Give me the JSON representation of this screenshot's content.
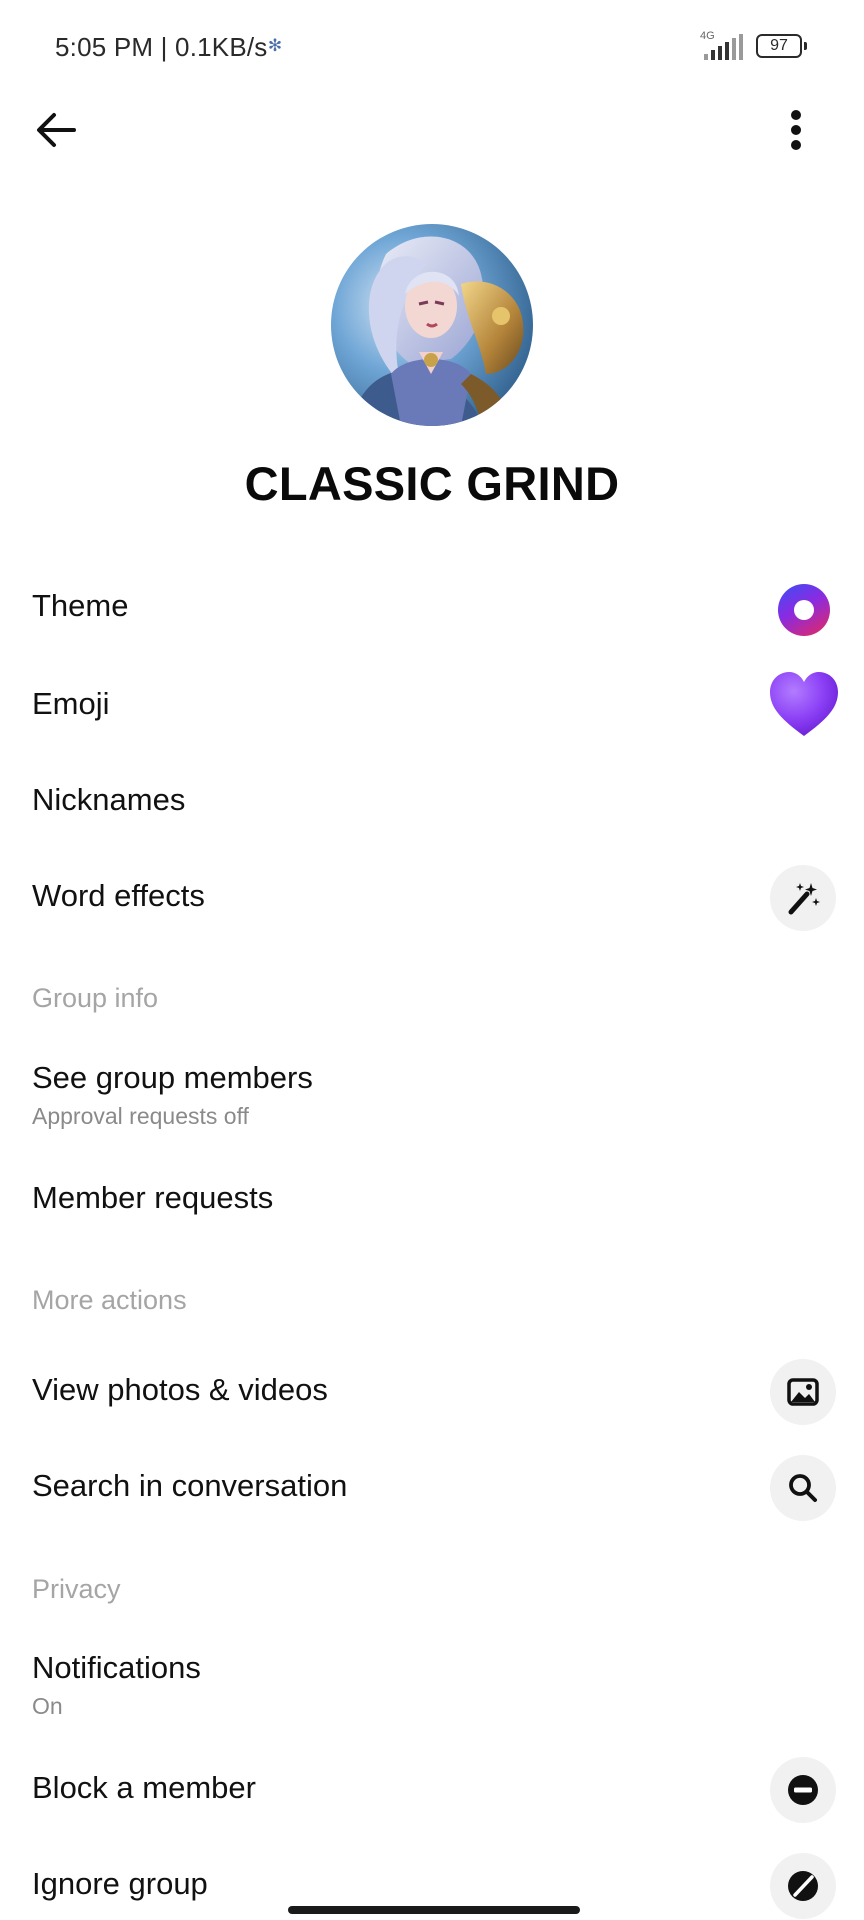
{
  "status_bar": {
    "time_speed": "5:05 PM | 0.1KB/s",
    "network_label": "4G",
    "battery": "97"
  },
  "top_bar": {
    "back_icon": "arrow-left-icon",
    "more_icon": "more-vertical-icon"
  },
  "header": {
    "group_name": "CLASSIC GRIND"
  },
  "settings": {
    "theme_label": "Theme",
    "emoji_label": "Emoji",
    "nicknames_label": "Nicknames",
    "word_effects_label": "Word effects"
  },
  "group_info": {
    "header": "Group info",
    "see_members_label": "See group members",
    "see_members_sub": "Approval requests off",
    "member_requests_label": "Member requests"
  },
  "more_actions": {
    "header": "More actions",
    "view_media_label": "View photos & videos",
    "search_label": "Search in conversation"
  },
  "privacy": {
    "header": "Privacy",
    "notifications_label": "Notifications",
    "notifications_sub": "On",
    "block_label": "Block a member",
    "ignore_label": "Ignore group"
  },
  "colors": {
    "theme_gradient_start": "#3b4ef5",
    "theme_gradient_end": "#e8285c",
    "emoji_heart": "#8b3ff5",
    "section_header": "#a5a5a5",
    "icon_bg": "#f1f1f1"
  }
}
